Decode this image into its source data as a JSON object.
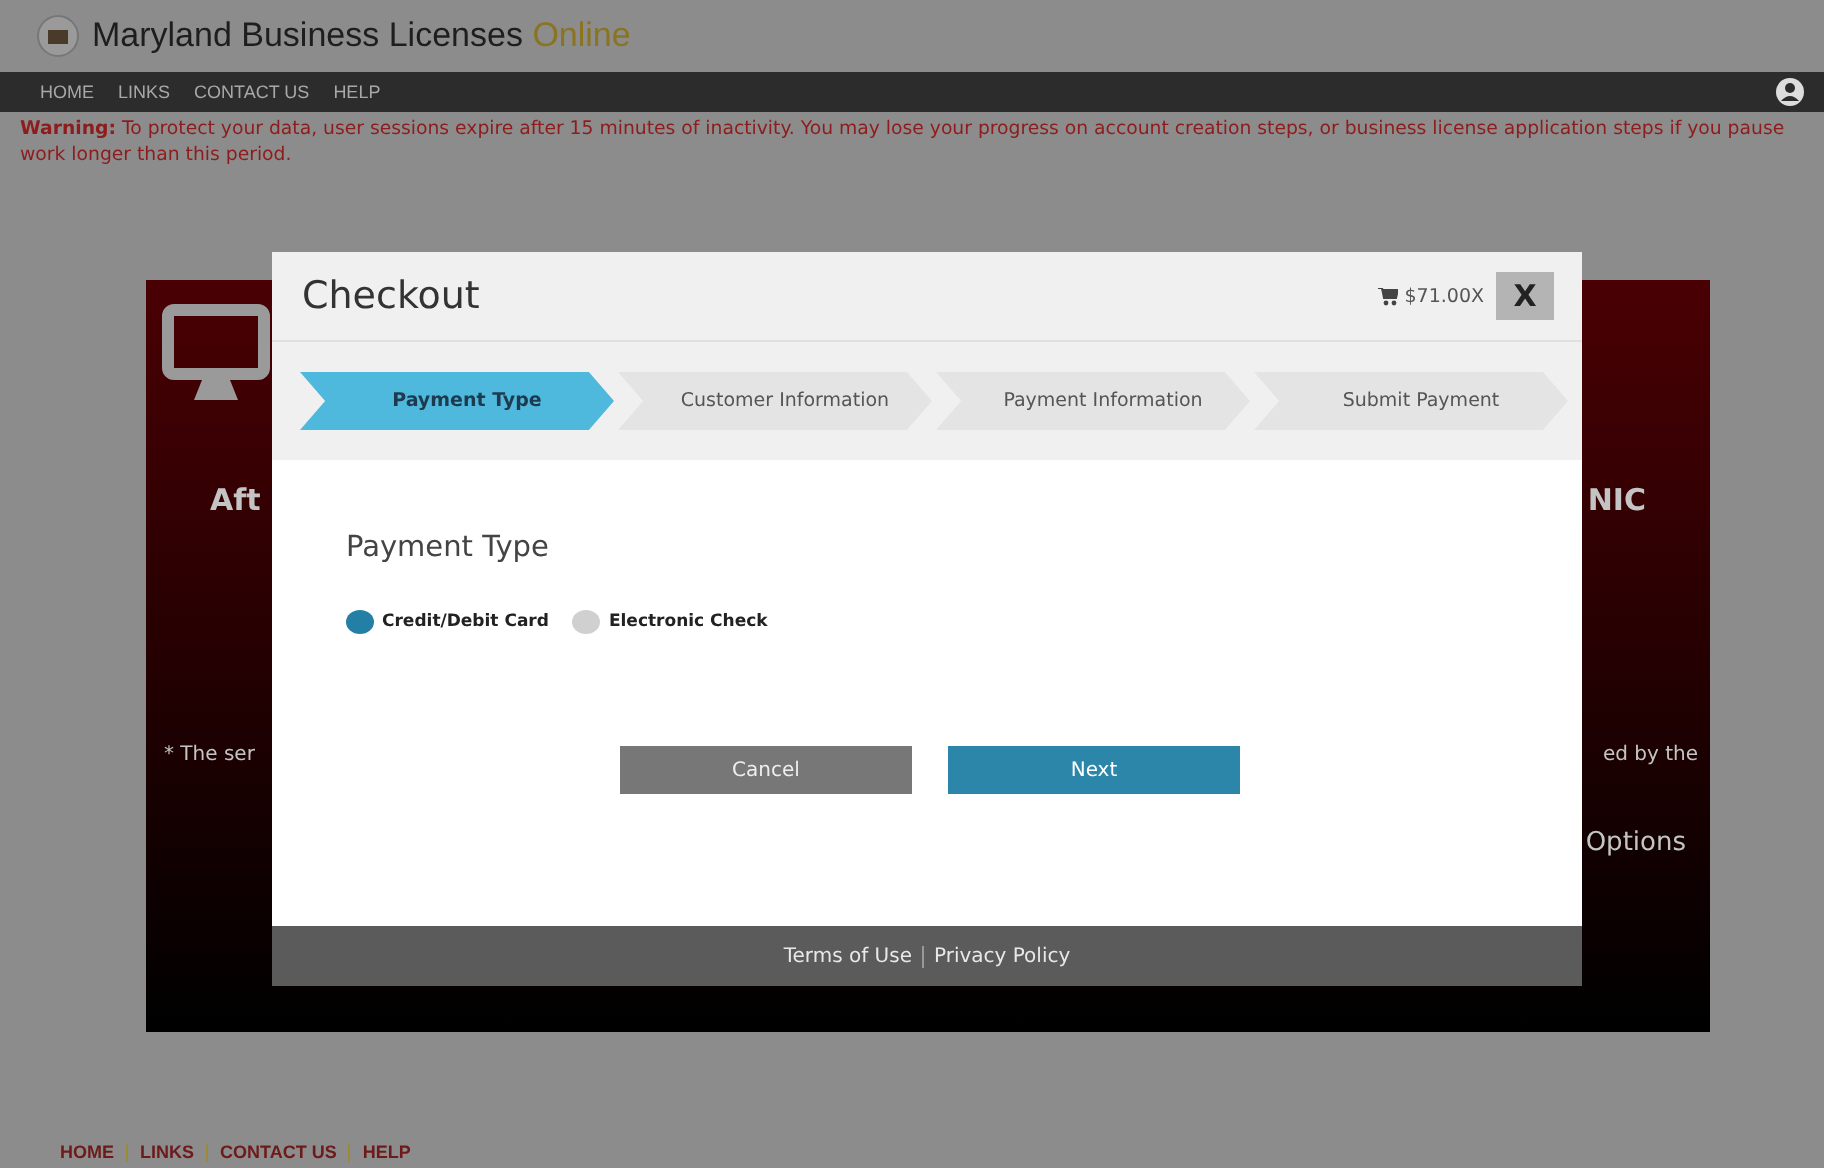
{
  "site": {
    "title": "Maryland Business Licenses",
    "title_accent": "Online"
  },
  "nav": [
    {
      "label": "HOME"
    },
    {
      "label": "LINKS"
    },
    {
      "label": "CONTACT US"
    },
    {
      "label": "HELP"
    }
  ],
  "warning": {
    "label": "Warning:",
    "text": "To protect your data, user sessions expire after 15 minutes of inactivity. You may lose your progress on account creation steps, or business license application steps if you pause work longer than this period."
  },
  "background_panel": {
    "heading_left": "Aft",
    "heading_right": "NIC",
    "note_left": "* The ser",
    "note_right": "ed by the",
    "link_right": "Options"
  },
  "modal": {
    "title": "Checkout",
    "cart_total": "$71.00X",
    "close": "X",
    "steps": [
      {
        "label": "Payment Type",
        "selected": true
      },
      {
        "label": "Customer Information",
        "selected": false
      },
      {
        "label": "Payment Information",
        "selected": false
      },
      {
        "label": "Submit Payment",
        "selected": false
      }
    ],
    "section_title": "Payment Type",
    "options": [
      {
        "label": "Credit/Debit Card",
        "selected": true
      },
      {
        "label": "Electronic Check",
        "selected": false
      }
    ],
    "buttons": [
      {
        "label": "Cancel",
        "kind": "secondary"
      },
      {
        "label": "Next",
        "kind": "primary"
      }
    ],
    "footer_links": [
      {
        "label": "Terms of Use"
      },
      {
        "label": "Privacy Policy"
      }
    ]
  },
  "footer_nav": [
    {
      "label": "HOME"
    },
    {
      "label": "LINKS"
    },
    {
      "label": "CONTACT US"
    },
    {
      "label": "HELP"
    }
  ]
}
